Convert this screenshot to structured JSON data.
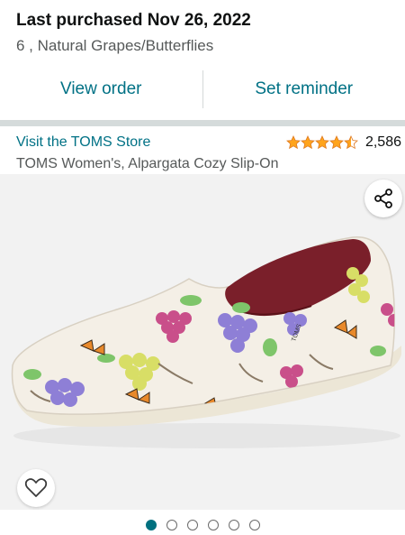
{
  "purchase": {
    "title": "Last purchased Nov 26, 2022",
    "variant": "6 , Natural Grapes/Butterflies"
  },
  "actions": {
    "view_order": "View order",
    "set_reminder": "Set reminder"
  },
  "store": {
    "link": "Visit the TOMS Store",
    "rating": 4.5,
    "rating_count": "2,586"
  },
  "product": {
    "title": "TOMS Women's, Alpargata Cozy Slip-On",
    "shoe_brand_mark": "TOMS",
    "image_description_icons": [
      "share-icon",
      "heart-icon"
    ]
  },
  "carousel": {
    "total": 6,
    "active_index": 0
  },
  "colors": {
    "link": "#007185",
    "star": "#ffa41c",
    "dot_active": "#00707f",
    "band": "#d5dbdb"
  }
}
